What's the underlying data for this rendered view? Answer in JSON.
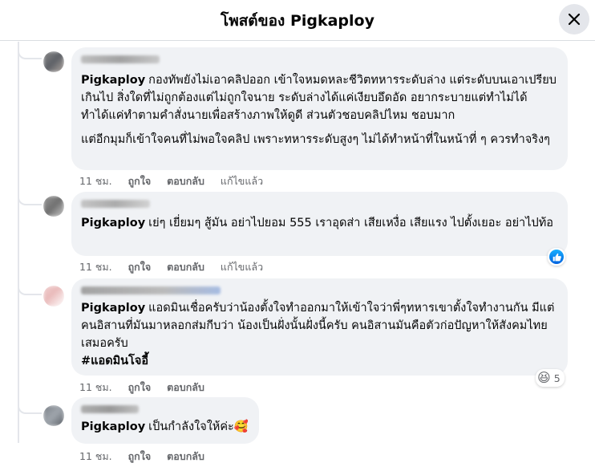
{
  "header": {
    "title": "โพสต์ของ Pigkaploy",
    "close_icon": "close-icon"
  },
  "comments": [
    {
      "author": "Pigkaploy",
      "text": "กองทัพยังไม่เอาคลิปออก เข้าใจหมดหละชีวิตทหารระดับล่าง แต่ระดับบนเอาเปรียบเกินไป สิ่งใดที่ไม่ถูกต้องแต่ไม่ถูกใจนาย ระดับล่างได้แค่เงียบอึดอัด อยากระบายแต่ทำไม่ได้ ทำได้แค่ทำตามคำสั่งนายเพื่อสร้างภาพให้ดูดี ส่วนตัวชอบคลิปไหม ชอบมาก",
      "text2": "แต่อีกมุมก็เข้าใจคนที่ไม่พอใจคลิป เพราะทหารระดับสูงๆ ไม่ได้ทำหน้าที่ในหน้าที่ ๆ ควรทำจริงๆ",
      "time": "11 ชม.",
      "like": "ถูกใจ",
      "reply": "ตอบกลับ",
      "edited": "แก้ไขแล้ว"
    },
    {
      "author": "Pigkaploy",
      "text": "เย่ๆ เยี่ยมๆ สู้มัน อย่าไปยอม 555 เราอุดส่า เสียเหงื่อ เสียแรง ไปตั้งเยอะ อย่าไปท้อ",
      "time": "11 ชม.",
      "like": "ถูกใจ",
      "reply": "ตอบกลับ",
      "edited": "แก้ไขแล้ว",
      "reaction_icon": "like-icon"
    },
    {
      "author": "Pigkaploy",
      "text": "แอดมินเชื่อครับว่าน้องตั้งใจทำออกมาให้เข้าใจว่าพี่ๆทหารเขาตั้งใจทำงานกัน มีแต่คนอิสานที่มันมาหลอกส่มกีบว่า น้องเป็นฝั่งนั้นฝั่งนี้ครับ คนอิสานมันคือตัวก่อปัญหาให้สังคมไทยเสมอครับ",
      "hashtag": "#แอดมินโจอี้",
      "time": "11 ชม.",
      "like": "ถูกใจ",
      "reply": "ตอบกลับ",
      "reaction_icon": "laughing-emoji-icon",
      "reaction_count": "5"
    },
    {
      "author": "Pigkaploy",
      "text": "เป็นกำลังใจให้ค่ะ🥰",
      "time": "11 ชม.",
      "like": "ถูกใจ",
      "reply": "ตอบกลับ"
    }
  ]
}
